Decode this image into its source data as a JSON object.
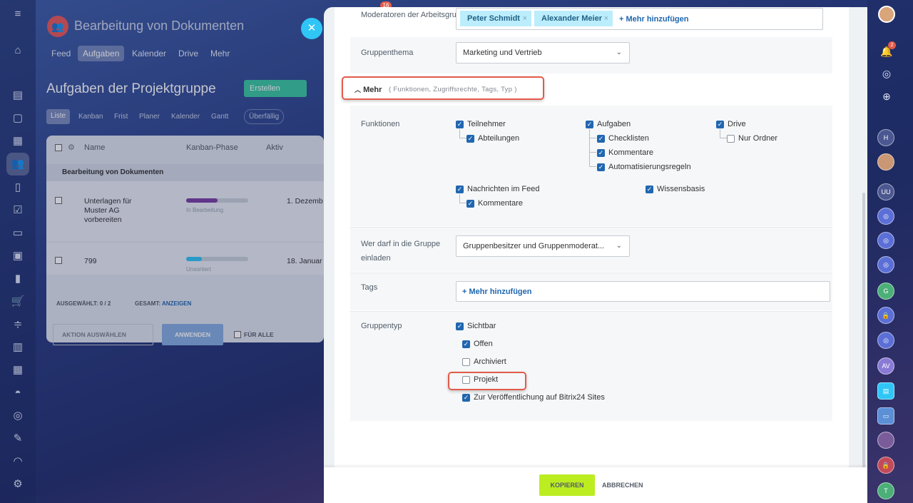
{
  "background": {
    "app_title": "Bearbeitung von Dokumenten",
    "nav_tabs": [
      "Feed",
      "Aufgaben",
      "Kalender",
      "Drive",
      "Mehr"
    ],
    "page_title": "Aufgaben der Projektgruppe",
    "create_button": "Erstellen",
    "view_tabs": [
      "Liste",
      "Kanban",
      "Frist",
      "Planer",
      "Kalender",
      "Gantt"
    ],
    "overdue_badge": "Überfällig",
    "table_headers": {
      "name": "Name",
      "phase": "Kanban-Phase",
      "active": "Aktiv"
    },
    "group_row": "Bearbeitung von Dokumenten",
    "rows": [
      {
        "name": "Unterlagen für Muster AG vorbereiten",
        "phase": "In Bearbeitung",
        "date": "1. Dezemb",
        "progress": 0.5,
        "color": "#7b3fa3"
      },
      {
        "name": "799",
        "phase": "Unsortiert",
        "date": "18. Januar",
        "progress": 0.25,
        "color": "#2fc6f6"
      }
    ],
    "selected_label": "AUSGEWÄHLT:",
    "selected_value": "0 / 2",
    "total_label": "GESAMT:",
    "total_link": "ANZEIGEN",
    "action_select": "AKTION AUSWÄHLEN",
    "apply_button": "ANWENDEN",
    "for_all": "FÜR ALLE",
    "notif_count": "16"
  },
  "form": {
    "moderators_label": "Moderatoren der Arbeitsgruppe",
    "moderators": [
      "Peter Schmidt",
      "Alexander Meier"
    ],
    "add_more": "Mehr hinzufügen",
    "topic_label": "Gruppenthema",
    "topic_value": "Marketing und Vertrieb",
    "more_toggle": "Mehr",
    "more_hint": "( Funktionen, Zugriffsrechte, Tags, Typ )",
    "functions_label": "Funktionen",
    "functions": {
      "teilnehmer": "Teilnehmer",
      "abteilungen": "Abteilungen",
      "aufgaben": "Aufgaben",
      "checklisten": "Checklisten",
      "kommentare": "Kommentare",
      "automatisierung": "Automatisierungsregeln",
      "drive": "Drive",
      "nur_ordner": "Nur Ordner",
      "nachrichten": "Nachrichten im Feed",
      "kommentare2": "Kommentare",
      "wissensbasis": "Wissensbasis"
    },
    "invite_label": "Wer darf in die Gruppe einladen",
    "invite_value": "Gruppenbesitzer und Gruppenmoderat...",
    "tags_label": "Tags",
    "tags_add": "Mehr hinzufügen",
    "type_label": "Gruppentyp",
    "types": {
      "sichtbar": "Sichtbar",
      "offen": "Offen",
      "archiviert": "Archiviert",
      "projekt": "Projekt",
      "sites": "Zur Veröffentlichung auf Bitrix24 Sites"
    }
  },
  "footer": {
    "copy": "KOPIEREN",
    "cancel": "ABBRECHEN"
  },
  "right_rail": {
    "notif_badge": "2",
    "avatars": [
      "H",
      "UU",
      "G",
      "AV",
      "T"
    ]
  },
  "colors": {
    "accent": "#2067b0",
    "copy_button": "#bbed21",
    "highlight": "#e35b4a"
  }
}
